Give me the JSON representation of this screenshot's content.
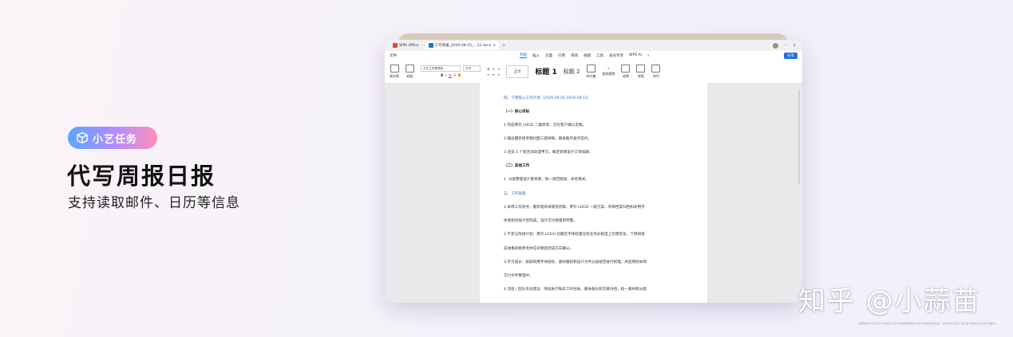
{
  "promo": {
    "badge": "小艺任务",
    "headline": "代写周报日报",
    "subline": "支持读取邮件、日历等信息"
  },
  "window": {
    "tabs": [
      {
        "label": "WPS Office"
      },
      {
        "label": "工作周报_2026-08-05_...12.docx"
      }
    ],
    "menu": [
      "文件",
      "开始",
      "插入",
      "页面",
      "引用",
      "审阅",
      "视图",
      "工具",
      "会员专享",
      "WPS AI"
    ],
    "share": "分享",
    "ribbon": {
      "format_painter": "格式刷",
      "paste": "粘贴",
      "font": "方正兰亭黑简体",
      "size": "五号",
      "style_normal": "正文",
      "style_h1": "标题 1",
      "style_h2": "标题 2",
      "styles": "样式集",
      "find_replace": "查找替换",
      "select": "选择",
      "layout": "排版",
      "typeset": "排列"
    }
  },
  "document": {
    "lines": [
      {
        "text": "四、下周核心工作计划（2026.08.05-2026.08.12）",
        "kind": "h"
      },
      {
        "text": "（一）核心目标",
        "kind": "b"
      },
      {
        "text": "1.完成茶饮 LOGO 二版修改、交付客户确认定稿。",
        "kind": "p"
      },
      {
        "text": "2.输出服装视觉稿封面三套样稿，跟进甄月金作签约。",
        "kind": "p"
      },
      {
        "text": "3.洽谈 2 个新咨询动漫甲方，确定新增设计订单排期。",
        "kind": "p"
      },
      {
        "text": "（二）其他工作",
        "kind": "b"
      },
      {
        "text": "1.  分类整理设计素材库，统一规范版层、命名格式。",
        "kind": "p"
      },
      {
        "text": "五、工作复盘",
        "kind": "h"
      },
      {
        "text": "1.本周工作亮点：服装电商详情页初稿、茶饮 LOGO 一版方案、项目档案归档和商用字",
        "kind": "p"
      },
      {
        "text": "体授权均按计划完成，设计交付质量更完整。",
        "kind": "p"
      },
      {
        "text": "2.不足与改进计划：茶饮 LOGO 初版在字体轻量化和主色彩程度上仍需优化，下周将提",
        "kind": "p"
      },
      {
        "text": "前收集风格参考并在初稿后完成方向确认。",
        "kind": "p"
      },
      {
        "text": "3.学习成长：跟踪商用字体授权、素材版权和设计文件分层规范进行梳理，并启用到本周",
        "kind": "p"
      },
      {
        "text": "交付文件整理中。",
        "kind": "p"
      },
      {
        "text": "4.流程 / 团队优化建议：持续执行每日工时台账、版本备份和交接归档，统一素材库分类",
        "kind": "p"
      }
    ]
  },
  "watermark": "知乎 @小蒜苗",
  "disclaimer": "页面数据均为示例,仅为功能演示;部分功能需要联网使用,部分功能需授权登录。实际效果以实际产品为准,内容由AI生成请仔细甄别。"
}
